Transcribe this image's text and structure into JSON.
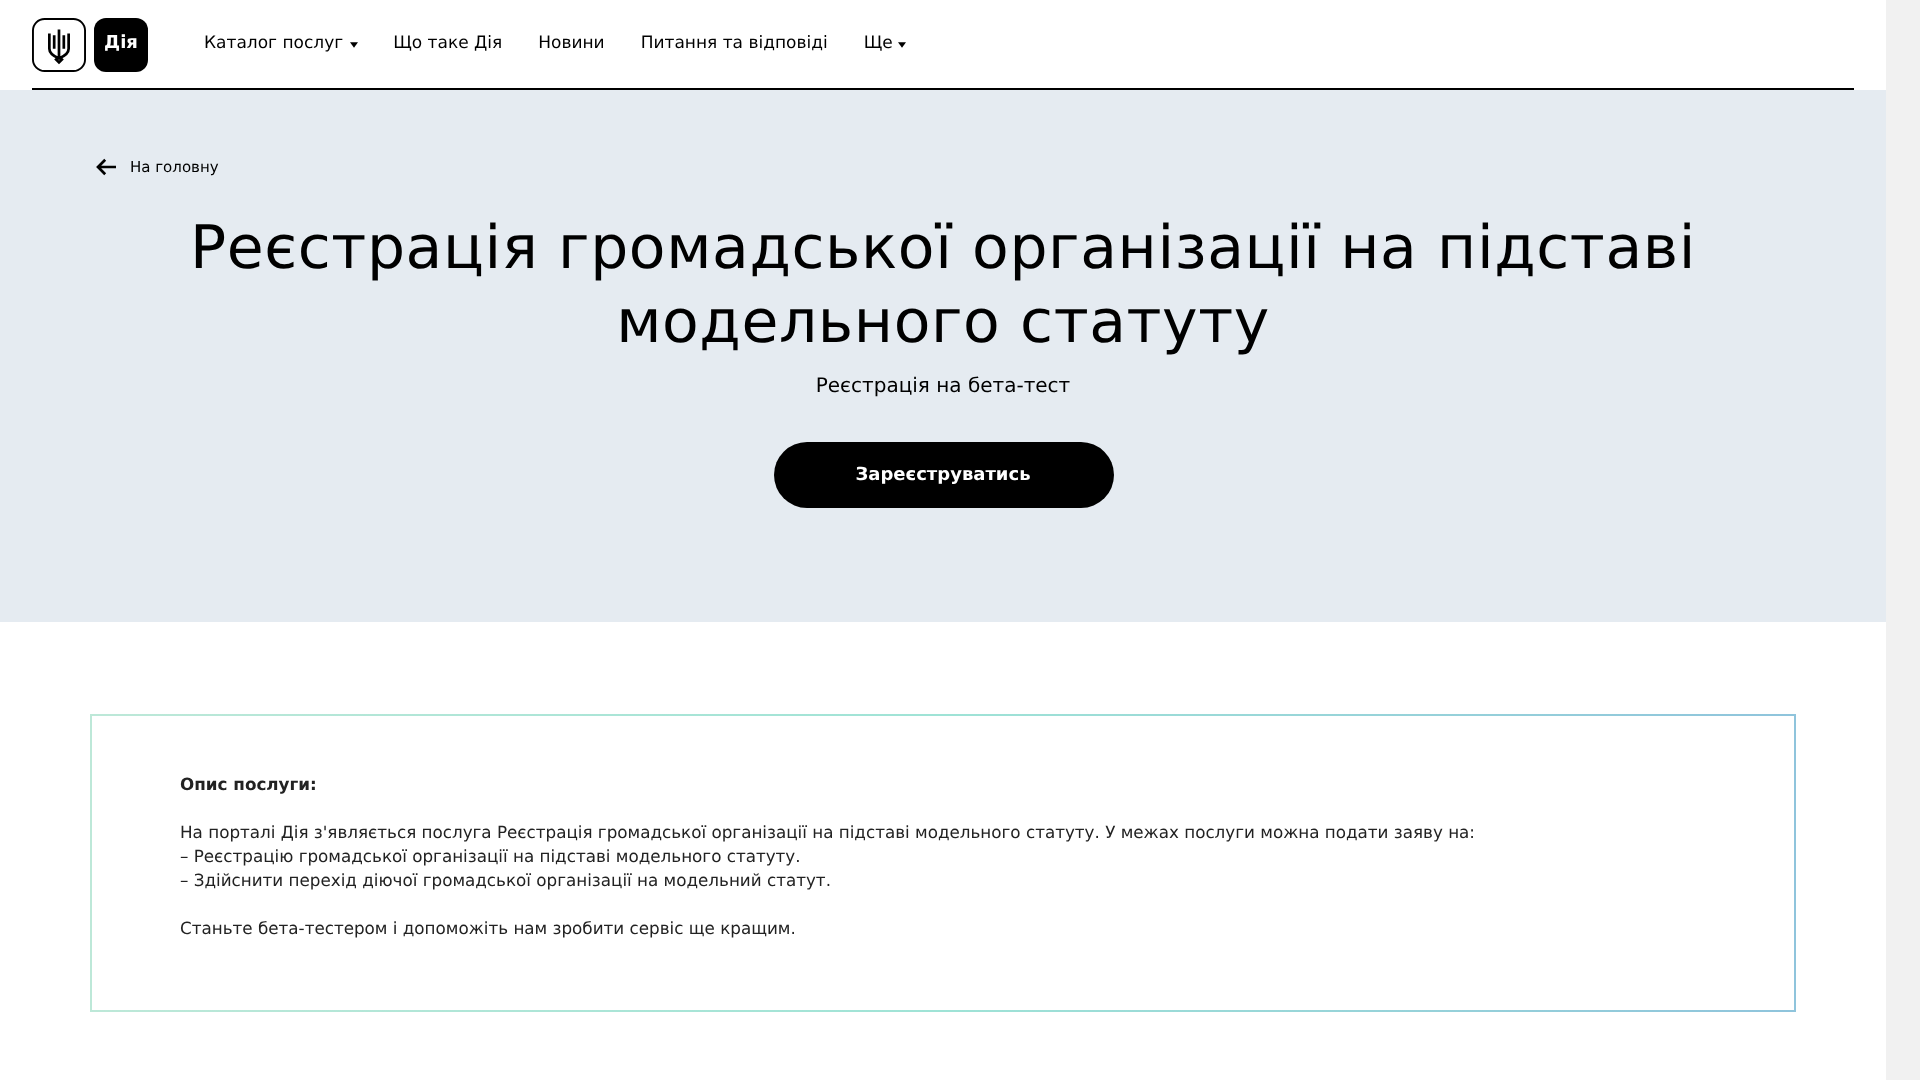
{
  "header": {
    "logo_text": "Дія",
    "nav": [
      {
        "label": "Каталог послуг",
        "dropdown": true
      },
      {
        "label": "Що таке Дія",
        "dropdown": false
      },
      {
        "label": "Новини",
        "dropdown": false
      },
      {
        "label": "Питання та відповіді",
        "dropdown": false
      },
      {
        "label": "Ще",
        "dropdown": true
      }
    ]
  },
  "hero": {
    "back_link": "На головну",
    "title": "Реєстрація громадської організації на підставі модельного статуту",
    "subtitle": "Реєстрація на бета-тест",
    "button": "Зареєструватись"
  },
  "description": {
    "heading": "Опис послуги:",
    "lines": [
      "На порталі Дія з'являється послуга Реєстрація громадської організації на підставі модельного статуту. У межах послуги можна подати заяву на:",
      "– Реєстрацію громадської організації на підставі модельного статуту.",
      "– Здійснити перехід діючої громадської організації на модельний статут."
    ],
    "closing": "Станьте бета-тестером і допоможіть нам зробити сервіс ще кращим."
  }
}
